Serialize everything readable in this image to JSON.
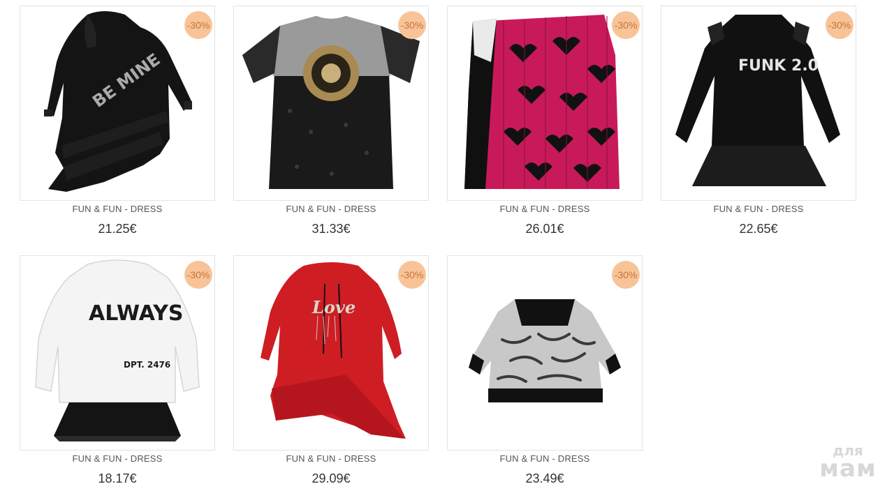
{
  "products": [
    {
      "name": "FUN & FUN - DRESS",
      "price": "21.25€",
      "discount": "-30%",
      "image": "black-ruffle-hoodie-dress",
      "print": "BE MINE"
    },
    {
      "name": "FUN & FUN - DRESS",
      "price": "31.33€",
      "discount": "-30%",
      "image": "black-silver-sequin-dress",
      "print": ""
    },
    {
      "name": "FUN & FUN - DRESS",
      "price": "26.01€",
      "discount": "-30%",
      "image": "pink-heart-pleated-dress",
      "print": ""
    },
    {
      "name": "FUN & FUN - DRESS",
      "price": "22.65€",
      "discount": "-30%",
      "image": "black-ruffle-dress",
      "print": "FUNK 2.0"
    },
    {
      "name": "FUN & FUN - DRESS",
      "price": "18.17€",
      "discount": "-30%",
      "image": "white-hoodie-tulle-dress",
      "print": "ALWAYS",
      "print2": "DPT. 2476"
    },
    {
      "name": "FUN & FUN - DRESS",
      "price": "29.09€",
      "discount": "-30%",
      "image": "red-hoodie-ruffle-dress",
      "print": "Love"
    },
    {
      "name": "FUN & FUN - DRESS",
      "price": "23.49€",
      "discount": "-30%",
      "image": "zebra-print-dress",
      "print": ""
    }
  ],
  "watermark": {
    "line1": "для",
    "line2": "мам"
  },
  "colors": {
    "badge_bg": "#f8c497",
    "badge_text": "#c7733a",
    "border": "#e3e3e3"
  }
}
